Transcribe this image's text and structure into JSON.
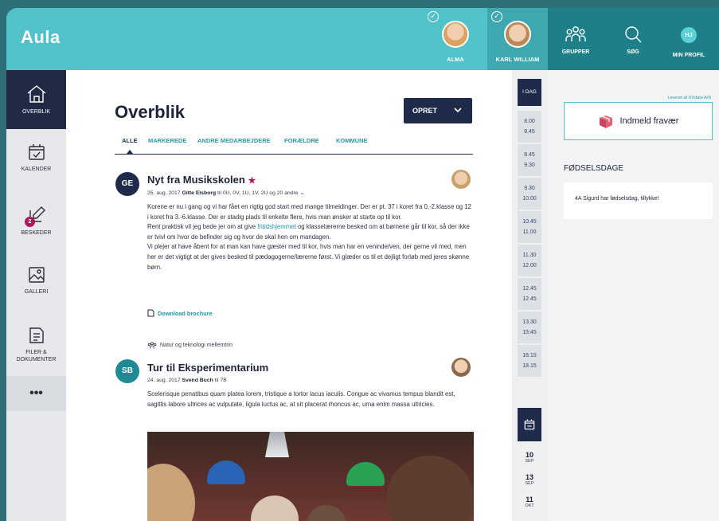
{
  "header": {
    "logo": "Aula",
    "children": [
      {
        "name": "ALMA"
      },
      {
        "name": "KARL WILLIAM"
      }
    ],
    "nav": {
      "groups": "GRUPPER",
      "search": "SØG",
      "profile": "MIN PROFIL",
      "profile_initials": "HJ"
    }
  },
  "sidebar": {
    "items": [
      {
        "label": "OVERBLIK"
      },
      {
        "label": "KALENDER"
      },
      {
        "label": "BESKEDER",
        "badge": "2"
      },
      {
        "label": "GALLERI"
      },
      {
        "label": "FILER &\nDOKUMENTER"
      },
      {
        "label": "•••"
      }
    ]
  },
  "main": {
    "title": "Overblik",
    "create_button": "OPRET",
    "tabs": [
      "ALLE",
      "MARKEREDE",
      "ANDRE MEDARBEJDERE",
      "FORÆLDRE",
      "KOMMUNE"
    ],
    "posts": [
      {
        "initials": "GE",
        "title": "Nyt fra Musikskolen",
        "star": "★",
        "date": "25. aug. 2017",
        "author": "Gitte Elsborg",
        "recipients": "til 0U, 0V, 1U, 1V, 2U og",
        "more_recipients": "20 andre ⌄",
        "p1": "Korene er nu i gang og vi har fået en rigtig god start med mange tilmeldinger. Der er pt. 37 i koret fra 0.-2.klasse og 12 i koret fra 3.-6.klasse. Der er stadig plads til enkelte flere, hvis man ønsker at starte op til kor.",
        "p2_before": "Rent praktisk vil jeg bede jer om at give",
        "p2_link": "fritidshjemmet",
        "p2_after": "og klasselærerne besked om at børnene går til kor, så der ikke er tvivl om hvor de befinder sig og hvor de skal hen om mandagen.",
        "p3": "Vi plejer at have åbent for at man kan have gæster med til kor, hvis man har en veninde/ven, der gerne vil med, men her er det vigtigt at der gives besked til pædagogerne/lærerne først. Vi glæder os til et dejligt forløb med jeres skønne børn.",
        "attachment": "Download brochure"
      },
      {
        "group": "Natur og teknologi mellemtrin",
        "initials": "SB",
        "title": "Tur til Eksperimentarium",
        "date": "24. aug. 2017",
        "author": "Svend Buch",
        "recipients": "til 7B",
        "body": "Scelerisque penatibus quam platea lorem, tristique a tortor lacus iaculis. Congue ac vivamus tempus blandit est, sagittis labore ultrices ac vulputate, ligula luctus ac, at sit placerat rhoncus ac, urna enim massa ultricies."
      }
    ]
  },
  "schedule": {
    "today_label": "I DAG",
    "slots": [
      [
        "8.00",
        "8.45"
      ],
      [
        "8.45",
        "9.30"
      ],
      [
        "9.30",
        "10.00"
      ],
      [
        "10.45",
        "11.00"
      ],
      [
        "11.30",
        "12.00"
      ],
      [
        "12.45",
        "12.45"
      ],
      [
        "13.30",
        "15:45"
      ],
      [
        "16:15",
        "18.15"
      ]
    ],
    "dates": [
      {
        "day": "10",
        "month": "SEP"
      },
      {
        "day": "13",
        "month": "SEP"
      },
      {
        "day": "11",
        "month": "OKT"
      }
    ]
  },
  "right": {
    "provider": "Leveret af UVdata A/S",
    "absence_button": "Indmeld fravær",
    "birthdays_heading": "FØDSELSDAGE",
    "birthday_text": "4A Sigurd har fødselsdag, tillykke!"
  },
  "colors": {
    "header": "#51c2c9",
    "header_dark": "#1f7f88",
    "navy": "#1f2b4a",
    "accent": "#b0175a",
    "link": "#1f97a3"
  }
}
